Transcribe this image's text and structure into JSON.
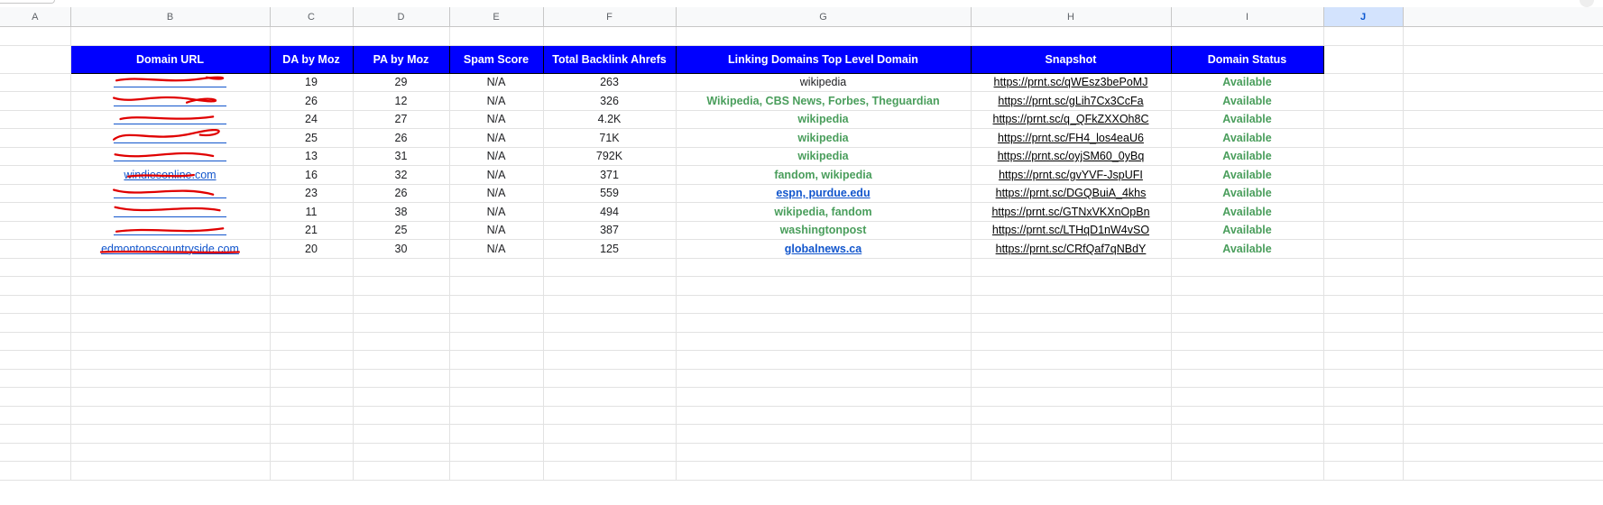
{
  "columns": [
    "A",
    "B",
    "C",
    "D",
    "E",
    "F",
    "G",
    "H",
    "I",
    "J"
  ],
  "selected_column": "J",
  "header": [
    "Domain URL",
    "DA by Moz",
    "PA by Moz",
    "Spam Score",
    "Total Backlink Ahrefs",
    "Linking Domains Top Level Domain",
    "Snapshot",
    "Domain Status"
  ],
  "rows": [
    {
      "domain": "",
      "redacted": true,
      "da": "19",
      "pa": "29",
      "spam": "N/A",
      "backlinks": "263",
      "ltld": "wikipedia",
      "ltld_style": "plain",
      "snapshot": "https://prnt.sc/qWEsz3bePoMJ",
      "status": "Available"
    },
    {
      "domain": "",
      "redacted": true,
      "da": "26",
      "pa": "12",
      "spam": "N/A",
      "backlinks": "326",
      "ltld": "Wikipedia, CBS News, Forbes, Theguardian",
      "ltld_style": "green",
      "snapshot": "https://prnt.sc/gLih7Cx3CcFa",
      "status": "Available"
    },
    {
      "domain": "",
      "redacted": true,
      "da": "24",
      "pa": "27",
      "spam": "N/A",
      "backlinks": "4.2K",
      "ltld": "wikipedia",
      "ltld_style": "green",
      "snapshot": "https://prnt.sc/q_QFkZXXOh8C",
      "status": "Available"
    },
    {
      "domain": "",
      "redacted": true,
      "da": "25",
      "pa": "26",
      "spam": "N/A",
      "backlinks": "71K",
      "ltld": "wikipedia",
      "ltld_style": "green",
      "snapshot": "https://prnt.sc/FH4_los4eaU6",
      "status": "Available"
    },
    {
      "domain": "",
      "redacted": true,
      "da": "13",
      "pa": "31",
      "spam": "N/A",
      "backlinks": "792K",
      "ltld": "wikipedia",
      "ltld_style": "green",
      "snapshot": "https://prnt.sc/oyjSM60_0yBq",
      "status": "Available"
    },
    {
      "domain": "windiesonline.com",
      "redacted": true,
      "da": "16",
      "pa": "32",
      "spam": "N/A",
      "backlinks": "371",
      "ltld": "fandom, wikipedia",
      "ltld_style": "green",
      "snapshot": "https://prnt.sc/gvYVF-JspUFI",
      "status": "Available"
    },
    {
      "domain": "",
      "redacted": true,
      "da": "23",
      "pa": "26",
      "spam": "N/A",
      "backlinks": "559",
      "ltld": "espn, purdue.edu",
      "ltld_style": "blue",
      "snapshot": "https://prnt.sc/DGQBuiA_4khs",
      "status": "Available"
    },
    {
      "domain": "",
      "redacted": true,
      "da": "11",
      "pa": "38",
      "spam": "N/A",
      "backlinks": "494",
      "ltld": "wikipedia, fandom",
      "ltld_style": "green",
      "snapshot": "https://prnt.sc/GTNxVKXnOpBn",
      "status": "Available"
    },
    {
      "domain": "",
      "redacted": true,
      "da": "21",
      "pa": "25",
      "spam": "N/A",
      "backlinks": "387",
      "ltld": "washingtonpost",
      "ltld_style": "green",
      "snapshot": "https://prnt.sc/LTHqD1nW4vSO",
      "status": "Available"
    },
    {
      "domain": "edmontonscountryside.com",
      "redacted": true,
      "da": "20",
      "pa": "30",
      "spam": "N/A",
      "backlinks": "125",
      "ltld": "globalnews.ca",
      "ltld_style": "blue",
      "snapshot": "https://prnt.sc/CRfQaf7qNBdY",
      "status": "Available"
    }
  ],
  "colors": {
    "header_bg": "#0000ff",
    "header_text": "#ffffff",
    "available": "#4a9e5c",
    "link": "#1155cc",
    "redaction": "#e00000",
    "selected_col": "#d3e3fd"
  }
}
